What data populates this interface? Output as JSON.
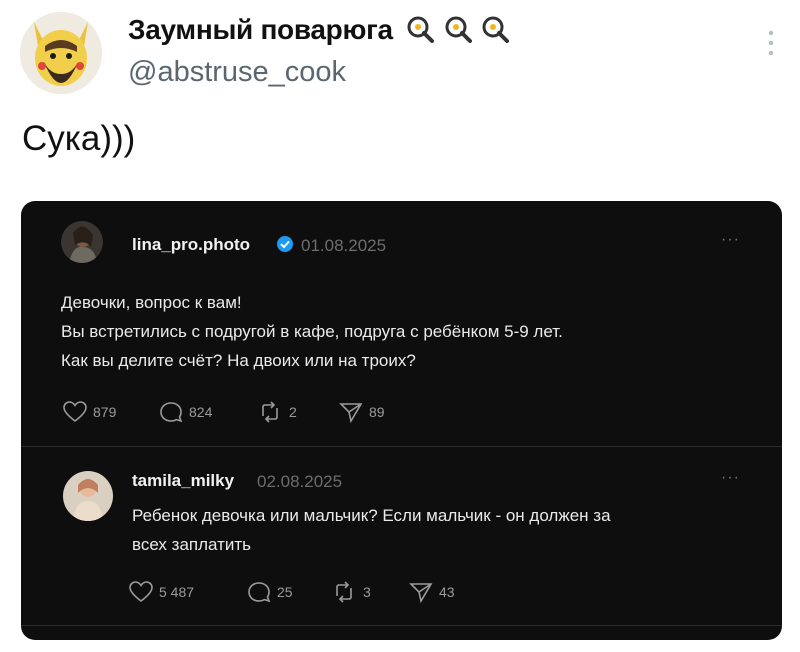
{
  "author": {
    "display_name": "Заумный поварюга",
    "handle": "@abstruse_cook",
    "name_icon": "frying-pan-egg-icon"
  },
  "tweet": {
    "text": "Сука)))"
  },
  "embedded": {
    "post": {
      "username": "lina_pro.photo",
      "verified": true,
      "date": "01.08.2025",
      "lines": [
        "Девочки, вопрос к вам!",
        "Вы встретились с подругой в кафе, подруга с ребёнком 5-9 лет.",
        "Как вы делите счёт? На двоих или на троих?"
      ],
      "likes": "879",
      "comments": "824",
      "reposts": "2",
      "shares": "89"
    },
    "reply": {
      "username": "tamila_milky",
      "date": "02.08.2025",
      "lines": [
        "Ребенок девочка или мальчик? Если мальчик - он должен за",
        "всех заплатить"
      ],
      "likes": "5 487",
      "comments": "25",
      "reposts": "3",
      "shares": "43"
    }
  },
  "colors": {
    "card_bg": "#0e0e0e",
    "verified": "#1d9bf0",
    "handle": "#5b6670"
  }
}
